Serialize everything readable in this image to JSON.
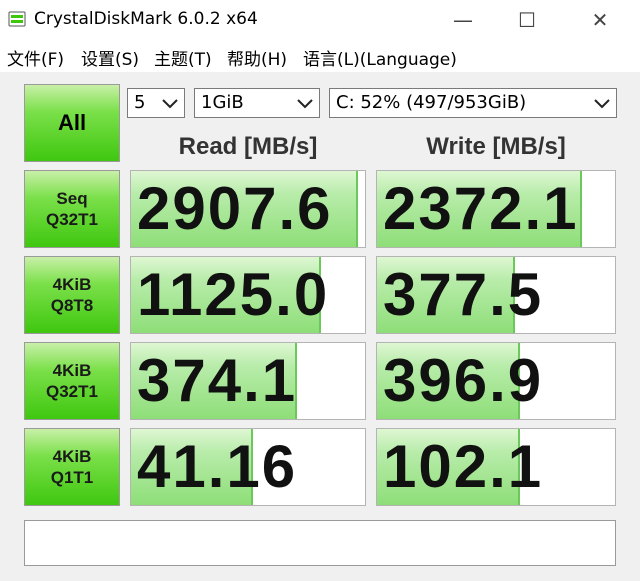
{
  "window": {
    "title": "CrystalDiskMark 6.0.2 x64",
    "icon": "crystaldiskmark-icon",
    "minimize_glyph": "—",
    "maximize_glyph": "☐",
    "close_glyph": "✕"
  },
  "menu": {
    "items": [
      "文件(F)",
      "设置(S)",
      "主题(T)",
      "帮助(H)",
      "语言(L)(Language)"
    ]
  },
  "controls": {
    "all_label": "All",
    "test_count": "5",
    "test_size": "1GiB",
    "drive": "C: 52% (497/953GiB)"
  },
  "headers": {
    "read": "Read [MB/s]",
    "write": "Write [MB/s]"
  },
  "tests": [
    {
      "line1": "Seq",
      "line2": "Q32T1",
      "read": "2907.6",
      "write": "2372.1",
      "read_fill": 0.97,
      "write_fill": 0.86
    },
    {
      "line1": "4KiB",
      "line2": "Q8T8",
      "read": "1125.0",
      "write": "377.5",
      "read_fill": 0.81,
      "write_fill": 0.58
    },
    {
      "line1": "4KiB",
      "line2": "Q32T1",
      "read": "374.1",
      "write": "396.9",
      "read_fill": 0.71,
      "write_fill": 0.6
    },
    {
      "line1": "4KiB",
      "line2": "Q1T1",
      "read": "41.16",
      "write": "102.1",
      "read_fill": 0.52,
      "write_fill": 0.6
    }
  ],
  "comment": "",
  "colors": {
    "button_green": "#3fc70f",
    "bar_green": "#8ede78",
    "background": "#f0f0f0"
  }
}
